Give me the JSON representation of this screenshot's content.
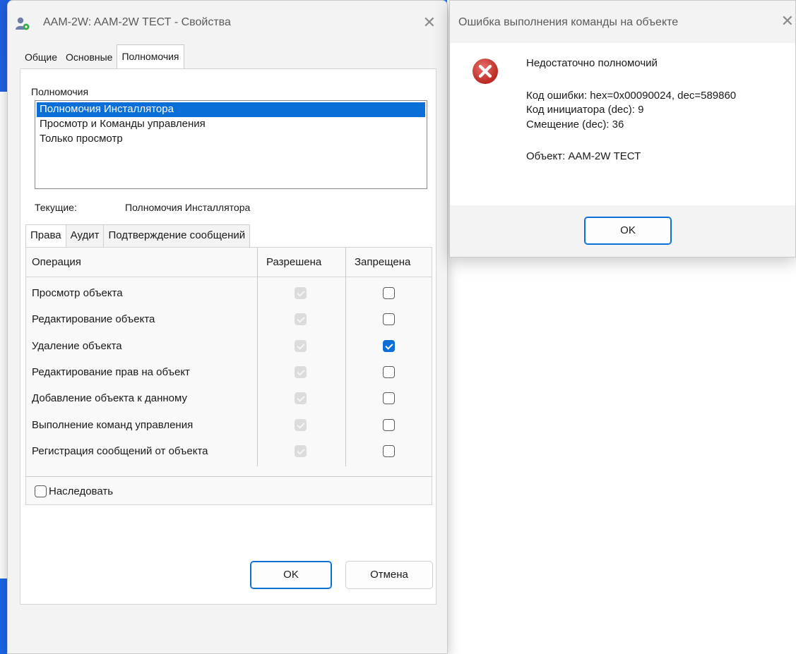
{
  "properties_window": {
    "title": "AAM-2W: AAM-2W ТЕСТ - Свойства",
    "close_glyph": "✕",
    "tabs": [
      {
        "label": "Общие"
      },
      {
        "label": "Основные"
      },
      {
        "label": "Полномочия"
      }
    ],
    "permissions_label": "Полномочия",
    "permissions_list": [
      {
        "label": "Полномочия Инсталлятора",
        "selected": true
      },
      {
        "label": "Просмотр и Команды управления",
        "selected": false
      },
      {
        "label": "Только просмотр",
        "selected": false
      }
    ],
    "current_label": "Текущие:",
    "current_value": "Полномочия Инсталлятора",
    "subtabs": [
      {
        "label": "Права"
      },
      {
        "label": "Аудит"
      },
      {
        "label": "Подтверждение сообщений"
      }
    ],
    "table": {
      "headers": {
        "operation": "Операция",
        "allowed": "Разрешена",
        "denied": "Запрещена"
      },
      "rows": [
        {
          "operation": "Просмотр объекта",
          "allowed": true,
          "denied": false
        },
        {
          "operation": "Редактирование объекта",
          "allowed": true,
          "denied": false
        },
        {
          "operation": "Удаление объекта",
          "allowed": true,
          "denied": true
        },
        {
          "operation": "Редактирование прав на объект",
          "allowed": true,
          "denied": false
        },
        {
          "operation": "Добавление объекта к данному",
          "allowed": true,
          "denied": false
        },
        {
          "operation": "Выполнение команд управления",
          "allowed": true,
          "denied": false
        },
        {
          "operation": "Регистрация сообщений от объекта",
          "allowed": true,
          "denied": false
        }
      ]
    },
    "inherit_label": "Наследовать",
    "inherit_checked": false,
    "ok_label": "OK",
    "cancel_label": "Отмена"
  },
  "error_dialog": {
    "title": "Ошибка выполнения команды на объекте",
    "close_glyph": "✕",
    "message": "Недостаточно полномочий",
    "error_code": "Код ошибки: hex=0x00090024, dec=589860",
    "initiator_code": "Код инициатора (dec): 9",
    "offset": "Смещение (dec): 36",
    "object": "Объект: AAM-2W ТЕСТ",
    "ok_label": "OK"
  },
  "colors": {
    "accent": "#0a6fd6",
    "error_red": "#c9302c",
    "wallpaper": "#1a66e8"
  }
}
